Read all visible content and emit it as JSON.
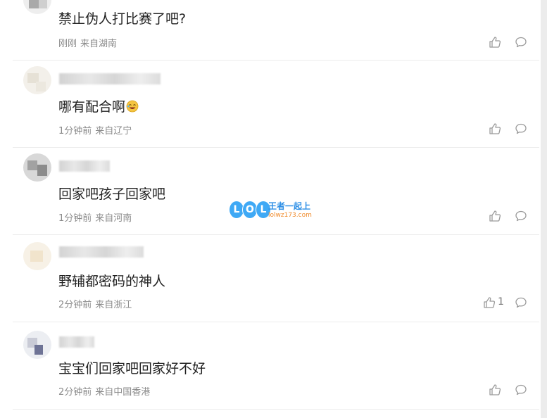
{
  "colors": {
    "text": "#222222",
    "meta": "#8a8a8a",
    "divider": "#ececec",
    "icon": "#9a9a9a"
  },
  "comments": [
    {
      "text": "禁止伪人打比赛了吧?",
      "time": "刚刚",
      "location": "来自湖南",
      "likes": ""
    },
    {
      "text": "哪有配合啊",
      "time": "1分钟前",
      "location": "来自辽宁",
      "likes": ""
    },
    {
      "text": "回家吧孩子回家吧",
      "time": "1分钟前",
      "location": "来自河南",
      "likes": ""
    },
    {
      "text": "野辅都密码的神人",
      "time": "2分钟前",
      "location": "来自浙江",
      "likes": "1"
    },
    {
      "text": "宝宝们回家吧回家好不好",
      "time": "2分钟前",
      "location": "来自中国香港",
      "likes": ""
    }
  ],
  "watermark": {
    "logo": [
      "L",
      "O",
      "L"
    ],
    "title": "王者一起上",
    "url": "lolwz173.com"
  },
  "icons": {
    "like": "thumbs-up-icon",
    "reply": "comment-bubble-icon",
    "emoji": "laughing-emoji-icon"
  }
}
